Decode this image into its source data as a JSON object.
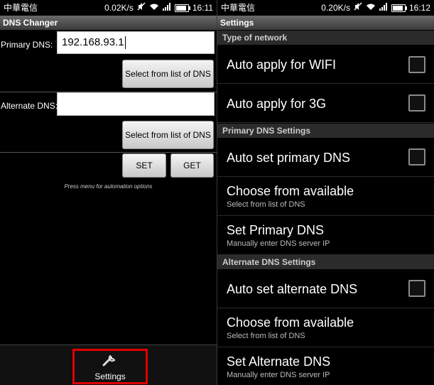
{
  "left": {
    "status": {
      "carrier": "中華電信",
      "speed": "0.02K/s",
      "time": "16:11"
    },
    "title": "DNS Changer",
    "primary_label": "Primary DNS:",
    "primary_value": "192.168.93.1",
    "select_label": "Select from list of DNS",
    "alternate_label": "Alternate DNS:",
    "alternate_value": "",
    "set_label": "SET",
    "get_label": "GET",
    "hint": "Press menu for automation options",
    "menu_settings": "Settings"
  },
  "right": {
    "status": {
      "carrier": "中華電信",
      "speed": "0.20K/s",
      "time": "16:12"
    },
    "title": "Settings",
    "sections": [
      {
        "title": "Type of network"
      },
      {
        "title": "Primary DNS Settings"
      },
      {
        "title": "Alternate DNS Settings"
      }
    ],
    "items": {
      "auto_wifi": {
        "title": "Auto apply for WIFI",
        "checked": false
      },
      "auto_3g": {
        "title": "Auto apply for 3G",
        "checked": false
      },
      "auto_primary": {
        "title": "Auto set primary DNS",
        "checked": false
      },
      "choose_primary": {
        "title": "Choose from available",
        "subtitle": "Select from list of DNS"
      },
      "set_primary": {
        "title": "Set Primary DNS",
        "subtitle": "Manually enter DNS server IP"
      },
      "auto_alternate": {
        "title": "Auto set alternate DNS",
        "checked": false
      },
      "choose_alternate": {
        "title": "Choose from available",
        "subtitle": "Select from list of DNS"
      },
      "set_alternate": {
        "title": "Set Alternate DNS",
        "subtitle": "Manually enter DNS server IP"
      }
    }
  },
  "colors": {
    "highlight": "#e00000",
    "section_bg": "#2b2b2b",
    "button_bg": "#dcdcdc"
  }
}
